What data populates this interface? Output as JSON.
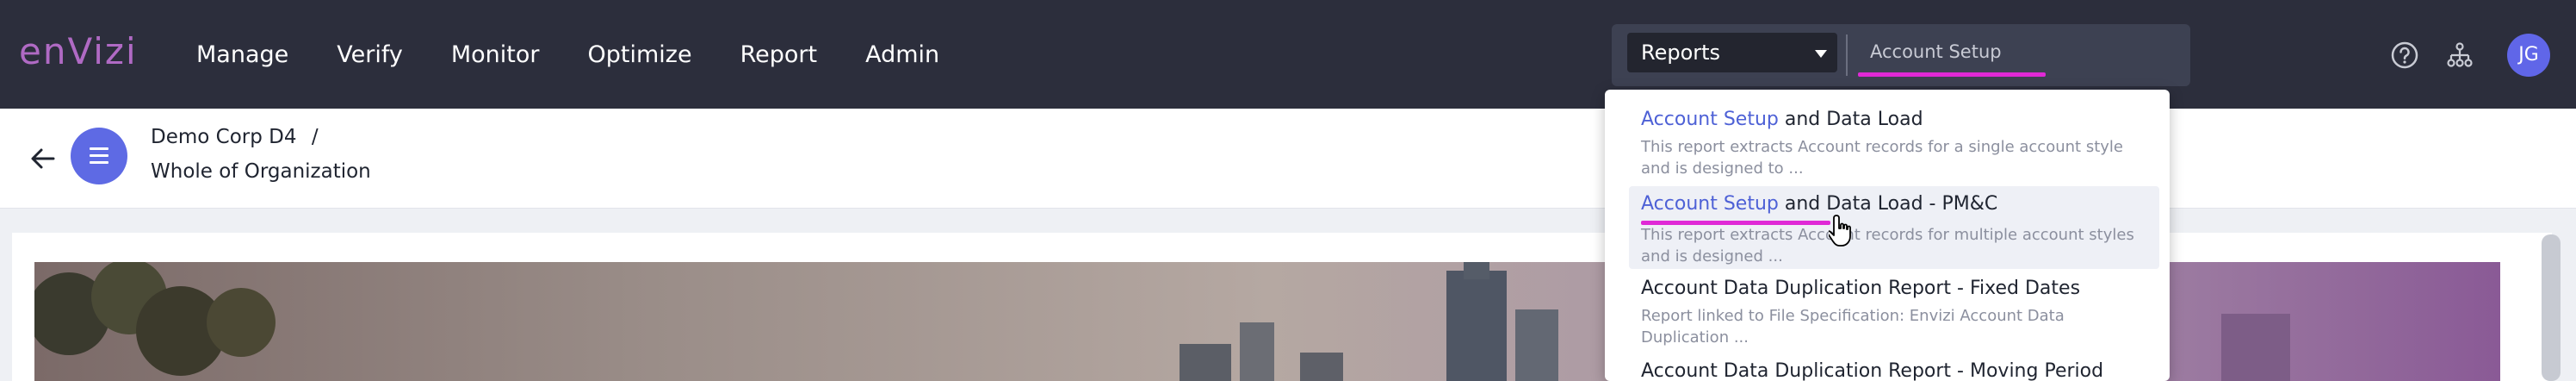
{
  "brand": {
    "logo": "enVizi",
    "logo_color": "#b06ac4"
  },
  "nav": {
    "items": [
      "Manage",
      "Verify",
      "Monitor",
      "Optimize",
      "Report",
      "Admin"
    ]
  },
  "search": {
    "scope_selected": "Reports",
    "query": "Account Setup",
    "highlight_color": "#e029d6"
  },
  "user": {
    "initials": "JG",
    "avatar_color": "#6066e8"
  },
  "breadcrumb": {
    "level1": "Demo Corp D4",
    "separator": "/",
    "level2": "Whole of Organization"
  },
  "results": [
    {
      "match": "Account Setup",
      "rest": " and Data Load",
      "description": "This report extracts Account records for a single account style and is designed to ..."
    },
    {
      "match": "Account Setup",
      "rest": " and Data Load - PM&C",
      "description": "This report extracts Account records for multiple account styles and is designed ..."
    },
    {
      "match": "",
      "rest": "Account Data Duplication Report - Fixed Dates",
      "description": "Report linked to File Specification: Envizi Account Data Duplication ..."
    },
    {
      "match": "",
      "rest": "Account Data Duplication Report - Moving Period",
      "description": ""
    }
  ],
  "icons": {
    "help": "help-circle-icon",
    "hierarchy": "org-hierarchy-icon",
    "back": "arrow-left-icon",
    "org": "menu-icon",
    "cursor": "hand-pointer-icon"
  }
}
